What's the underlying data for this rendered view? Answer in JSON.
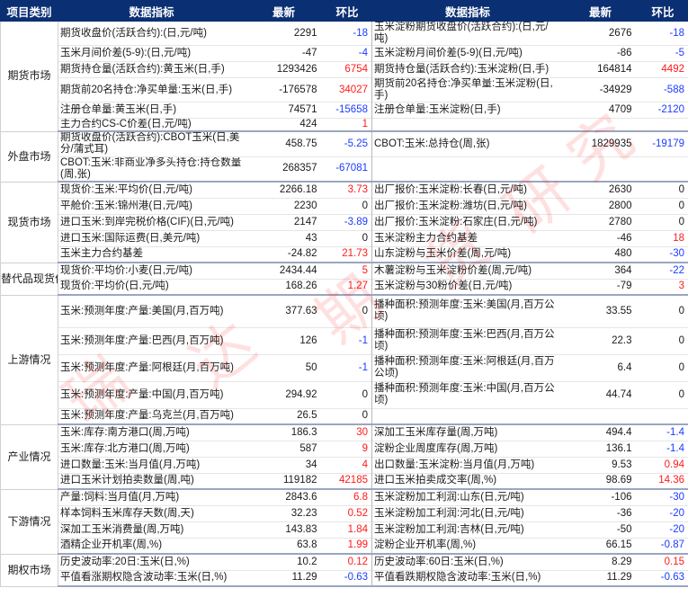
{
  "header": {
    "category": "项目类别",
    "indicator": "数据指标",
    "latest": "最新",
    "change": "环比"
  },
  "watermark": "瑞达期货研究",
  "colors": {
    "header_bg": "#0b2f73",
    "positive": "#ff1a1a",
    "negative": "#1a3cff"
  },
  "sections": [
    {
      "category": "期货市场",
      "rows": [
        {
          "l": {
            "name": "期货收盘价(活跃合约):(日,元/吨)",
            "latest": "2291",
            "change": "-18"
          },
          "r": {
            "name": "玉米淀粉期货收盘价(活跃合约):(日,元/吨)",
            "latest": "2676",
            "change": "-18"
          }
        },
        {
          "l": {
            "name": "玉米月间价差(5-9):(日,元/吨)",
            "latest": "-47",
            "change": "-4"
          },
          "r": {
            "name": "玉米淀粉月间价差(5-9)(日,元/吨)",
            "latest": "-86",
            "change": "-5"
          }
        },
        {
          "l": {
            "name": "期货持仓量(活跃合约):黄玉米(日,手)",
            "latest": "1293426",
            "change": "6754"
          },
          "r": {
            "name": "期货持仓量(活跃合约):玉米淀粉(日,手)",
            "latest": "164814",
            "change": "4492"
          }
        },
        {
          "l": {
            "name": "期货前20名持仓:净买单量:玉米(日,手)",
            "latest": "-176578",
            "change": "34027"
          },
          "r": {
            "name": "期货前20名持仓:净买单量:玉米淀粉(日,手)",
            "latest": "-34929",
            "change": "-588"
          }
        },
        {
          "l": {
            "name": "注册仓单量:黄玉米(日,手)",
            "latest": "74571",
            "change": "-15658"
          },
          "r": {
            "name": "注册仓单量:玉米淀粉(日,手)",
            "latest": "4709",
            "change": "-2120"
          }
        },
        {
          "l": {
            "name": "主力合约CS-C价差(日,元/吨)",
            "latest": "424",
            "change": "1"
          },
          "r": {
            "name": "",
            "latest": "",
            "change": ""
          }
        }
      ]
    },
    {
      "category": "外盘市场",
      "rows": [
        {
          "l": {
            "name": "期货收盘价(活跃合约):CBOT玉米(日,美分/蒲式耳)",
            "latest": "458.75",
            "change": "-5.25"
          },
          "r": {
            "name": "CBOT:玉米:总持仓(周,张)",
            "latest": "1829935",
            "change": "-19179"
          }
        },
        {
          "l": {
            "name": "CBOT:玉米:非商业净多头持仓:持仓数量(周,张)",
            "latest": "268357",
            "change": "-67081"
          },
          "r": {
            "name": "",
            "latest": "",
            "change": ""
          }
        }
      ]
    },
    {
      "category": "现货市场",
      "rows": [
        {
          "l": {
            "name": "现货价:玉米:平均价(日,元/吨)",
            "latest": "2266.18",
            "change": "3.73"
          },
          "r": {
            "name": "出厂报价:玉米淀粉:长春(日,元/吨)",
            "latest": "2630",
            "change": "0"
          }
        },
        {
          "l": {
            "name": "平舱价:玉米:锦州港(日,元/吨)",
            "latest": "2230",
            "change": "0"
          },
          "r": {
            "name": "出厂报价:玉米淀粉:潍坊(日,元/吨)",
            "latest": "2800",
            "change": "0"
          }
        },
        {
          "l": {
            "name": "进口玉米:到岸完税价格(CIF)(日,元/吨)",
            "latest": "2147",
            "change": "-3.89"
          },
          "r": {
            "name": "出厂报价:玉米淀粉:石家庄(日,元/吨)",
            "latest": "2780",
            "change": "0"
          }
        },
        {
          "l": {
            "name": "进口玉米:国际运费(日,美元/吨)",
            "latest": "43",
            "change": "0"
          },
          "r": {
            "name": "玉米淀粉主力合约基差",
            "latest": "-46",
            "change": "18"
          }
        },
        {
          "l": {
            "name": "玉米主力合约基差",
            "latest": "-24.82",
            "change": "21.73"
          },
          "r": {
            "name": "山东淀粉与玉米价差(周,元/吨)",
            "latest": "480",
            "change": "-30"
          }
        }
      ]
    },
    {
      "category": "替代品现货价格",
      "rows": [
        {
          "l": {
            "name": "现货价:平均价:小麦(日,元/吨)",
            "latest": "2434.44",
            "change": "5"
          },
          "r": {
            "name": "木薯淀粉与玉米淀粉价差(周,元/吨)",
            "latest": "364",
            "change": "-22"
          }
        },
        {
          "l": {
            "name": "现货价:平均价(日,元/吨)",
            "latest": "168.26",
            "change": "1.27"
          },
          "r": {
            "name": "玉米淀粉与30粉价差(日,元/吨)",
            "latest": "-79",
            "change": "3"
          }
        }
      ]
    },
    {
      "category": "上游情况",
      "rows": [
        {
          "l": {
            "name": "玉米:预测年度:产量:美国(月,百万吨)",
            "latest": "377.63",
            "change": "0"
          },
          "r": {
            "name": "播种面积:预测年度:玉米:美国(月,百万公顷)",
            "latest": "33.55",
            "change": "0"
          }
        },
        {
          "l": {
            "name": "玉米:预测年度:产量:巴西(月,百万吨)",
            "latest": "126",
            "change": "-1"
          },
          "r": {
            "name": "播种面积:预测年度:玉米:巴西(月,百万公顷)",
            "latest": "22.3",
            "change": "0"
          }
        },
        {
          "l": {
            "name": "玉米:预测年度:产量:阿根廷(月,百万吨)",
            "latest": "50",
            "change": "-1"
          },
          "r": {
            "name": "播种面积:预测年度:玉米:阿根廷(月,百万公顷)",
            "latest": "6.4",
            "change": "0"
          }
        },
        {
          "l": {
            "name": "玉米:预测年度:产量:中国(月,百万吨)",
            "latest": "294.92",
            "change": "0"
          },
          "r": {
            "name": "播种面积:预测年度:玉米:中国(月,百万公顷)",
            "latest": "44.74",
            "change": "0"
          }
        },
        {
          "l": {
            "name": "玉米:预测年度:产量:乌克兰(月,百万吨)",
            "latest": "26.5",
            "change": "0"
          },
          "r": {
            "name": "",
            "latest": "",
            "change": ""
          }
        }
      ]
    },
    {
      "category": "产业情况",
      "rows": [
        {
          "l": {
            "name": "玉米:库存:南方港口(周,万吨)",
            "latest": "186.3",
            "change": "30"
          },
          "r": {
            "name": "深加工玉米库存量(周,万吨)",
            "latest": "494.4",
            "change": "-1.4"
          }
        },
        {
          "l": {
            "name": "玉米:库存:北方港口(周,万吨)",
            "latest": "587",
            "change": "9"
          },
          "r": {
            "name": "淀粉企业周度库存(周,万吨)",
            "latest": "136.1",
            "change": "-1.4"
          }
        },
        {
          "l": {
            "name": "进口数量:玉米:当月值(月,万吨)",
            "latest": "34",
            "change": "4"
          },
          "r": {
            "name": "出口数量:玉米淀粉:当月值(月,万吨)",
            "latest": "9.53",
            "change": "0.94"
          }
        },
        {
          "l": {
            "name": "进口玉米计划拍卖数量(周,吨)",
            "latest": "119182",
            "change": "42185"
          },
          "r": {
            "name": "进口玉米拍卖成交率(周,%)",
            "latest": "98.69",
            "change": "14.36"
          }
        }
      ]
    },
    {
      "category": "下游情况",
      "rows": [
        {
          "l": {
            "name": "产量:饲料:当月值(月,万吨)",
            "latest": "2843.6",
            "change": "6.8"
          },
          "r": {
            "name": "玉米淀粉加工利润:山东(日,元/吨)",
            "latest": "-106",
            "change": "-30"
          }
        },
        {
          "l": {
            "name": "样本饲料玉米库存天数(周,天)",
            "latest": "32.23",
            "change": "0.52"
          },
          "r": {
            "name": "玉米淀粉加工利润:河北(日,元/吨)",
            "latest": "-36",
            "change": "-20"
          }
        },
        {
          "l": {
            "name": "深加工玉米消费量(周,万吨)",
            "latest": "143.83",
            "change": "1.84"
          },
          "r": {
            "name": "玉米淀粉加工利润:吉林(日,元/吨)",
            "latest": "-50",
            "change": "-20"
          }
        },
        {
          "l": {
            "name": "酒精企业开机率(周,%)",
            "latest": "63.8",
            "change": "1.99"
          },
          "r": {
            "name": "淀粉企业开机率(周,%)",
            "latest": "66.15",
            "change": "-0.87"
          }
        }
      ]
    },
    {
      "category": "期权市场",
      "rows": [
        {
          "l": {
            "name": "历史波动率:20日:玉米(日,%)",
            "latest": "10.2",
            "change": "0.12"
          },
          "r": {
            "name": "历史波动率:60日:玉米(日,%)",
            "latest": "8.29",
            "change": "0.15"
          }
        },
        {
          "l": {
            "name": "平值看涨期权隐含波动率:玉米(日,%)",
            "latest": "11.29",
            "change": "-0.63"
          },
          "r": {
            "name": "平值看跌期权隐含波动率:玉米(日,%)",
            "latest": "11.29",
            "change": "-0.63"
          }
        }
      ]
    }
  ]
}
